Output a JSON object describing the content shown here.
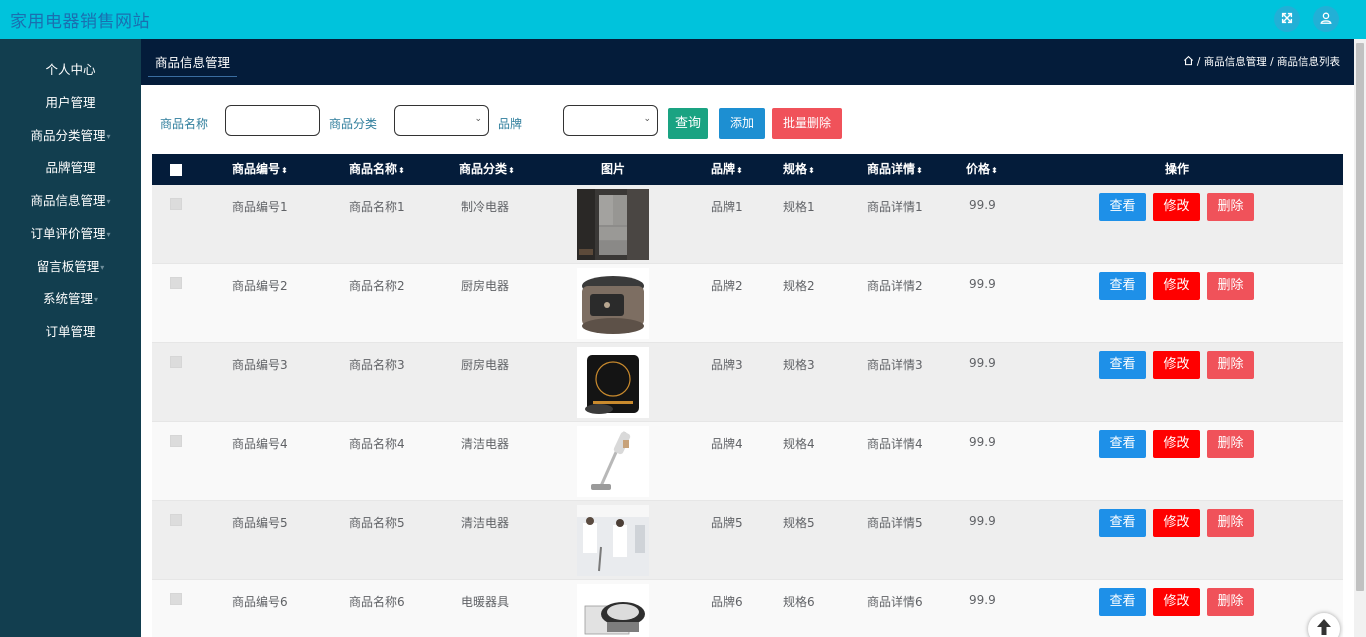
{
  "header": {
    "site_title": "家用电器销售网站",
    "fullscreen_icon": "fullscreen-icon",
    "user_icon": "user-icon"
  },
  "sidebar": {
    "items": [
      {
        "label": "个人中心",
        "has_caret": false
      },
      {
        "label": "用户管理",
        "has_caret": false
      },
      {
        "label": "商品分类管理",
        "has_caret": true
      },
      {
        "label": "品牌管理",
        "has_caret": false
      },
      {
        "label": "商品信息管理",
        "has_caret": true
      },
      {
        "label": "订单评价管理",
        "has_caret": true
      },
      {
        "label": "留言板管理",
        "has_caret": true
      },
      {
        "label": "系统管理",
        "has_caret": true
      },
      {
        "label": "订单管理",
        "has_caret": false
      }
    ]
  },
  "page": {
    "tab_title": "商品信息管理",
    "breadcrumb": [
      "商品信息管理",
      "商品信息列表"
    ],
    "breadcrumb_sep": "/"
  },
  "filters": {
    "name_label": "商品名称",
    "name_value": "",
    "category_label": "商品分类",
    "category_value": "",
    "brand_label": "品牌",
    "brand_value": "",
    "search_button": "查询",
    "add_button": "添加",
    "batch_delete_button": "批量删除"
  },
  "table": {
    "columns": [
      "商品编号",
      "商品名称",
      "商品分类",
      "图片",
      "品牌",
      "规格",
      "商品详情",
      "价格",
      "操作"
    ],
    "sort_icon": "⬍",
    "rows": [
      {
        "code": "商品编号1",
        "name": "商品名称1",
        "category": "制冷电器",
        "image": "refrigerator",
        "brand": "品牌1",
        "spec": "规格1",
        "detail": "商品详情1",
        "price": "99.9"
      },
      {
        "code": "商品编号2",
        "name": "商品名称2",
        "category": "厨房电器",
        "image": "rice-cooker",
        "brand": "品牌2",
        "spec": "规格2",
        "detail": "商品详情2",
        "price": "99.9"
      },
      {
        "code": "商品编号3",
        "name": "商品名称3",
        "category": "厨房电器",
        "image": "induction-cooker",
        "brand": "品牌3",
        "spec": "规格3",
        "detail": "商品详情3",
        "price": "99.9"
      },
      {
        "code": "商品编号4",
        "name": "商品名称4",
        "category": "清洁电器",
        "image": "stick-vacuum",
        "brand": "品牌4",
        "spec": "规格4",
        "detail": "商品详情4",
        "price": "99.9"
      },
      {
        "code": "商品编号5",
        "name": "商品名称5",
        "category": "清洁电器",
        "image": "floor-cleaner",
        "brand": "品牌5",
        "spec": "规格5",
        "detail": "商品详情5",
        "price": "99.9"
      },
      {
        "code": "商品编号6",
        "name": "商品名称6",
        "category": "电暖器具",
        "image": "heater",
        "brand": "品牌6",
        "spec": "规格6",
        "detail": "商品详情6",
        "price": "99.9"
      }
    ],
    "actions": {
      "view": "查看",
      "edit": "修改",
      "delete": "删除"
    }
  },
  "colors": {
    "topbar": "#00c3dc",
    "sidebar": "#123e4f",
    "header_dark": "#041c3a",
    "view_button": "#1e90e8",
    "edit_button": "#ff0000",
    "delete_button": "#f0525a",
    "search_button": "#1aa382",
    "add_button": "#1d8fd2"
  },
  "back_to_top_icon": "arrow-up-icon"
}
